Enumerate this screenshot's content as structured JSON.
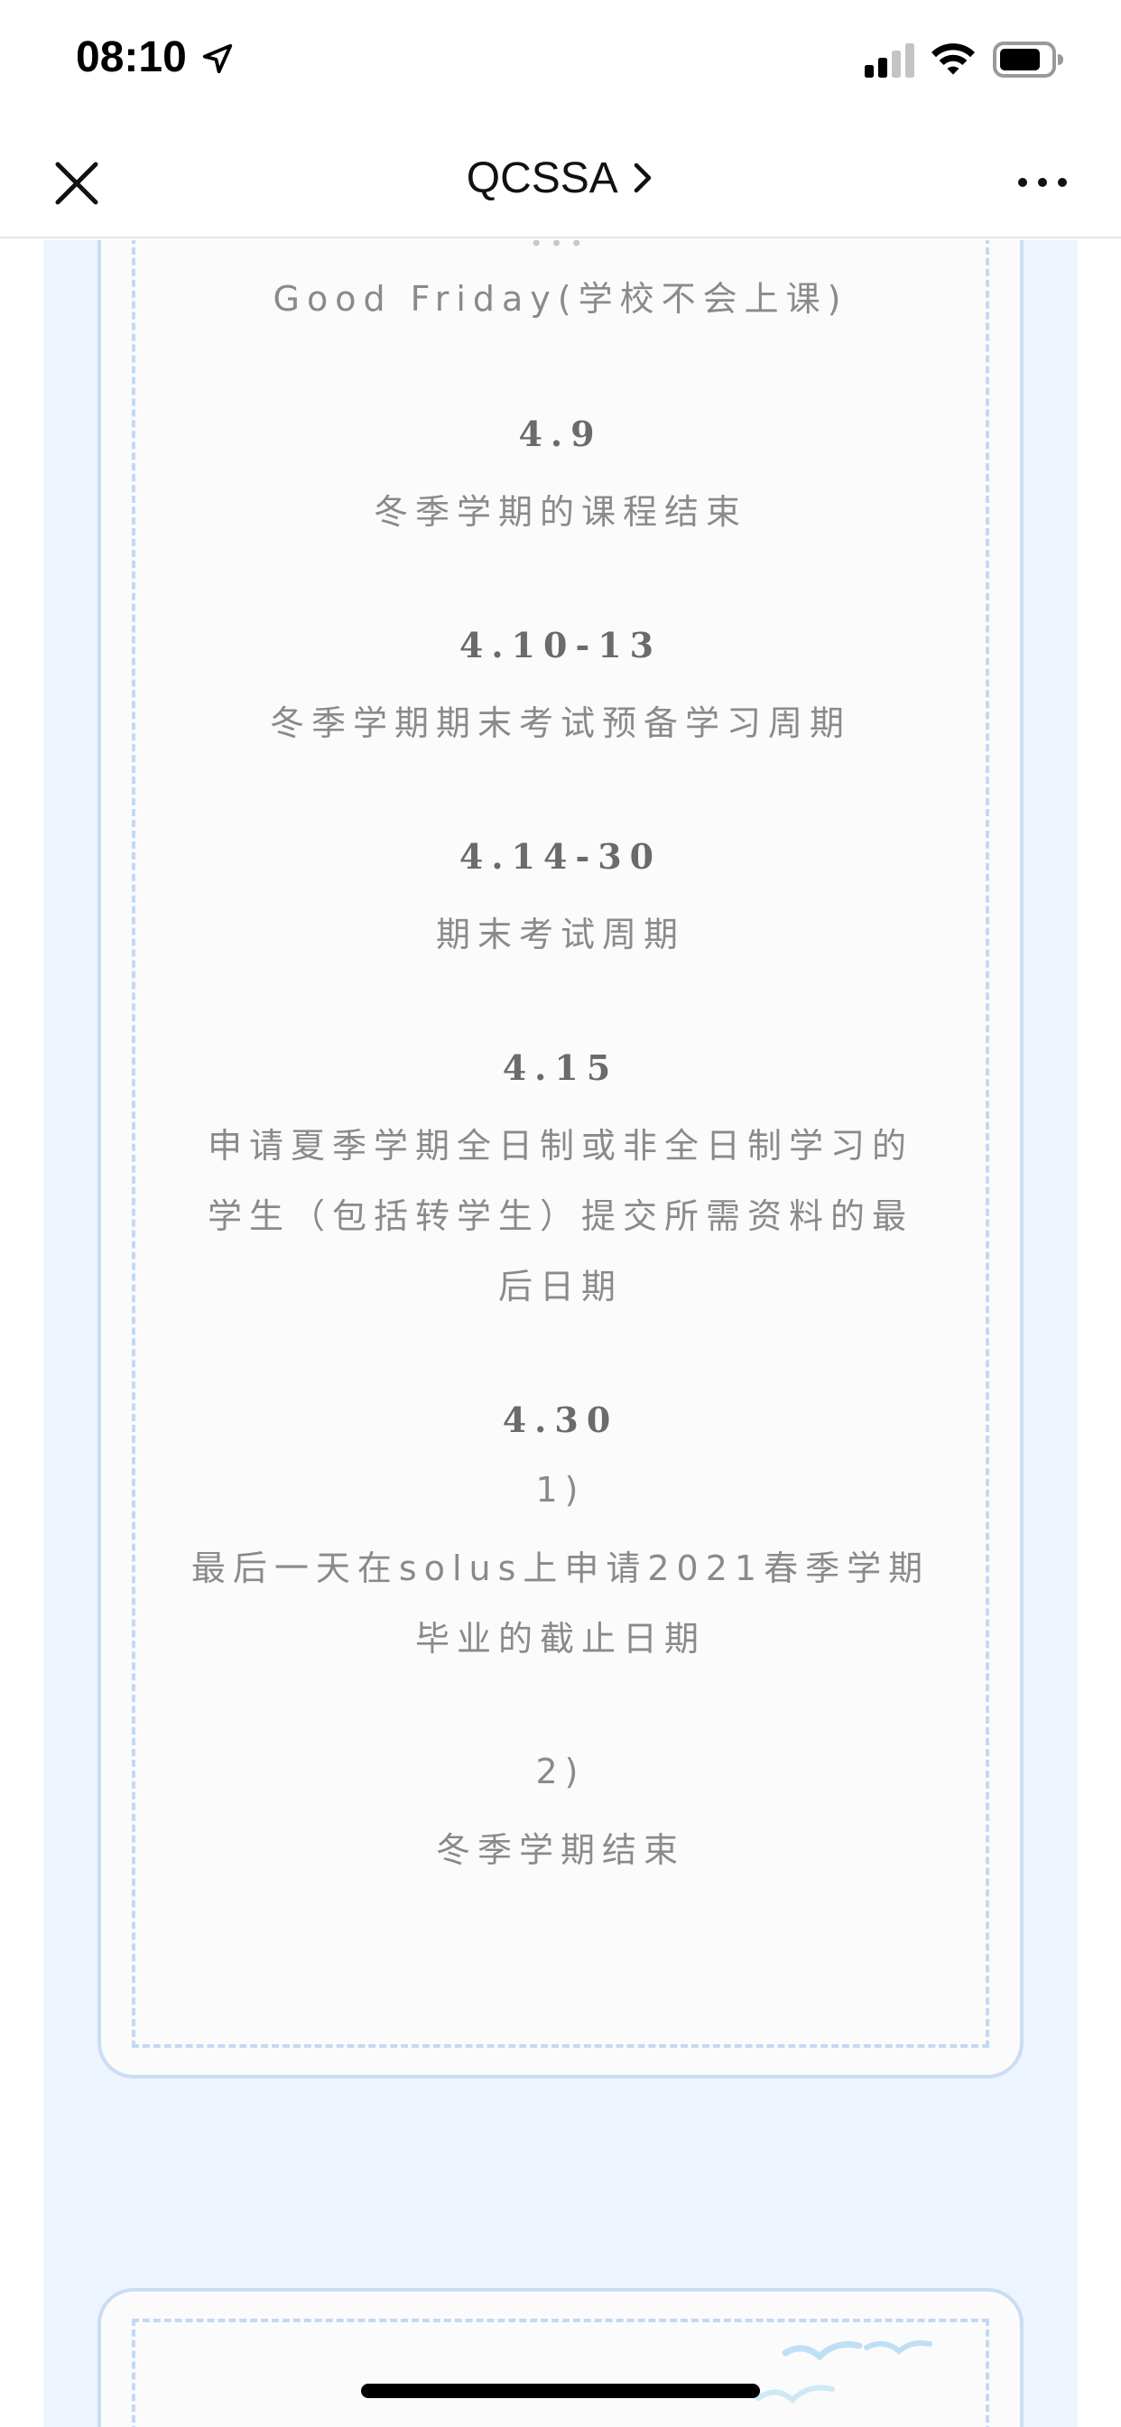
{
  "status_bar": {
    "time": "08:10",
    "icons": [
      "location-arrow-icon",
      "cellular-signal-icon",
      "wifi-icon",
      "battery-icon"
    ]
  },
  "nav": {
    "title": "QCSSA",
    "icons": [
      "close-icon",
      "chevron-right-icon",
      "more-icon"
    ]
  },
  "schedule": {
    "partial_top": "...",
    "good_friday": "Good Friday(学校不会上课)",
    "items": [
      {
        "date": "4.9",
        "lines": [
          "冬季学期的课程结束"
        ]
      },
      {
        "date": "4.10-13",
        "lines": [
          "冬季学期期末考试预备学习周期"
        ]
      },
      {
        "date": "4.14-30",
        "lines": [
          "期末考试周期"
        ]
      },
      {
        "date": "4.15",
        "lines": [
          "申请夏季学期全日制或非全日制学习的",
          "学生（包括转学生）提交所需资料的最",
          "后日期"
        ]
      },
      {
        "date": "4.30",
        "lines": [
          "1)",
          "最后一天在solus上申请2021春季学期",
          "毕业的截止日期",
          "2)",
          "冬季学期结束"
        ]
      }
    ]
  },
  "colors": {
    "background_panel": "#eef4fd",
    "card_border": "#c9ddf5",
    "text": "#8a8a8a",
    "date_text": "#6b6b6b"
  }
}
